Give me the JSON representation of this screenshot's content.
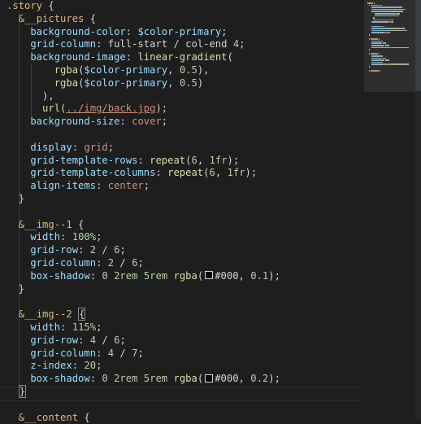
{
  "colors": {
    "background": "#1e1e1e",
    "selector": "#d7ba7d",
    "property": "#9cdcfe",
    "value": "#ce9178",
    "number": "#b5cea8",
    "function": "#dcdcaa",
    "variable": "#9cdcfe",
    "punct": "#d4d4d4",
    "link": "#ce9178",
    "comment": "#6a9955"
  },
  "code_lines": [
    [
      {
        "t": ".story",
        "c": "selector"
      },
      {
        "t": " {",
        "c": "punct"
      }
    ],
    [
      {
        "t": "  &",
        "c": "selector"
      },
      {
        "t": "__pictures",
        "c": "selector"
      },
      {
        "t": " {",
        "c": "punct"
      }
    ],
    [
      {
        "t": "    background-color",
        "c": "property"
      },
      {
        "t": ": ",
        "c": "punct"
      },
      {
        "t": "$color-primary",
        "c": "variable"
      },
      {
        "t": ";",
        "c": "punct"
      }
    ],
    [
      {
        "t": "    grid-column",
        "c": "property"
      },
      {
        "t": ": full-start / col-end ",
        "c": "punct"
      },
      {
        "t": "4",
        "c": "number"
      },
      {
        "t": ";",
        "c": "punct"
      }
    ],
    [
      {
        "t": "    background-image",
        "c": "property"
      },
      {
        "t": ": ",
        "c": "punct"
      },
      {
        "t": "linear-gradient",
        "c": "function"
      },
      {
        "t": "(",
        "c": "punct"
      }
    ],
    [
      {
        "t": "        rgba",
        "c": "function"
      },
      {
        "t": "(",
        "c": "punct"
      },
      {
        "t": "$color-primary",
        "c": "variable"
      },
      {
        "t": ", ",
        "c": "punct"
      },
      {
        "t": "0.5",
        "c": "number"
      },
      {
        "t": "),",
        "c": "punct"
      }
    ],
    [
      {
        "t": "        rgba",
        "c": "function"
      },
      {
        "t": "(",
        "c": "punct"
      },
      {
        "t": "$color-primary",
        "c": "variable"
      },
      {
        "t": ", ",
        "c": "punct"
      },
      {
        "t": "0.5",
        "c": "number"
      },
      {
        "t": ")",
        "c": "punct"
      }
    ],
    [
      {
        "t": "      ),",
        "c": "punct"
      }
    ],
    [
      {
        "t": "      url",
        "c": "function"
      },
      {
        "t": "(",
        "c": "punct"
      },
      {
        "t": "../img/back.jpg",
        "c": "link"
      },
      {
        "t": ");",
        "c": "punct"
      }
    ],
    [
      {
        "t": "    background-size",
        "c": "property"
      },
      {
        "t": ": ",
        "c": "punct"
      },
      {
        "t": "cover",
        "c": "value"
      },
      {
        "t": ";",
        "c": "punct"
      }
    ],
    [],
    [
      {
        "t": "    display",
        "c": "property"
      },
      {
        "t": ": ",
        "c": "punct"
      },
      {
        "t": "grid",
        "c": "value"
      },
      {
        "t": ";",
        "c": "punct"
      }
    ],
    [
      {
        "t": "    grid-template-rows",
        "c": "property"
      },
      {
        "t": ": ",
        "c": "punct"
      },
      {
        "t": "repeat",
        "c": "function"
      },
      {
        "t": "(",
        "c": "punct"
      },
      {
        "t": "6",
        "c": "number"
      },
      {
        "t": ", ",
        "c": "punct"
      },
      {
        "t": "1fr",
        "c": "number"
      },
      {
        "t": ");",
        "c": "punct"
      }
    ],
    [
      {
        "t": "    grid-template-columns",
        "c": "property"
      },
      {
        "t": ": ",
        "c": "punct"
      },
      {
        "t": "repeat",
        "c": "function"
      },
      {
        "t": "(",
        "c": "punct"
      },
      {
        "t": "6",
        "c": "number"
      },
      {
        "t": ", ",
        "c": "punct"
      },
      {
        "t": "1fr",
        "c": "number"
      },
      {
        "t": ");",
        "c": "punct"
      }
    ],
    [
      {
        "t": "    align-items",
        "c": "property"
      },
      {
        "t": ": ",
        "c": "punct"
      },
      {
        "t": "center",
        "c": "value"
      },
      {
        "t": ";",
        "c": "punct"
      }
    ],
    [
      {
        "t": "  }",
        "c": "punct"
      }
    ],
    [],
    [
      {
        "t": "  &",
        "c": "selector"
      },
      {
        "t": "__img--1",
        "c": "selector"
      },
      {
        "t": " {",
        "c": "punct"
      }
    ],
    [
      {
        "t": "    width",
        "c": "property"
      },
      {
        "t": ": ",
        "c": "punct"
      },
      {
        "t": "100%",
        "c": "number"
      },
      {
        "t": ";",
        "c": "punct"
      }
    ],
    [
      {
        "t": "    grid-row",
        "c": "property"
      },
      {
        "t": ": ",
        "c": "punct"
      },
      {
        "t": "2",
        "c": "number"
      },
      {
        "t": " / ",
        "c": "punct"
      },
      {
        "t": "6",
        "c": "number"
      },
      {
        "t": ";",
        "c": "punct"
      }
    ],
    [
      {
        "t": "    grid-column",
        "c": "property"
      },
      {
        "t": ": ",
        "c": "punct"
      },
      {
        "t": "2",
        "c": "number"
      },
      {
        "t": " / ",
        "c": "punct"
      },
      {
        "t": "6",
        "c": "number"
      },
      {
        "t": ";",
        "c": "punct"
      }
    ],
    [
      {
        "t": "    box-shadow",
        "c": "property"
      },
      {
        "t": ": ",
        "c": "punct"
      },
      {
        "t": "0 2rem 5rem ",
        "c": "number"
      },
      {
        "t": "rgba",
        "c": "function"
      },
      {
        "t": "(",
        "c": "punct"
      },
      {
        "t": "",
        "c": "swatch"
      },
      {
        "t": "#000",
        "c": "punct"
      },
      {
        "t": ", ",
        "c": "punct"
      },
      {
        "t": "0.1",
        "c": "number"
      },
      {
        "t": ");",
        "c": "punct"
      }
    ],
    [
      {
        "t": "  }",
        "c": "punct"
      }
    ],
    [],
    [
      {
        "t": "  &",
        "c": "selector"
      },
      {
        "t": "__img--2",
        "c": "selector"
      },
      {
        "t": " ",
        "c": "punct"
      },
      {
        "t": "{",
        "c": "cursor"
      }
    ],
    [
      {
        "t": "    width",
        "c": "property"
      },
      {
        "t": ": ",
        "c": "punct"
      },
      {
        "t": "115%",
        "c": "number"
      },
      {
        "t": ";",
        "c": "punct"
      }
    ],
    [
      {
        "t": "    grid-row",
        "c": "property"
      },
      {
        "t": ": ",
        "c": "punct"
      },
      {
        "t": "4",
        "c": "number"
      },
      {
        "t": " / ",
        "c": "punct"
      },
      {
        "t": "6",
        "c": "number"
      },
      {
        "t": ";",
        "c": "punct"
      }
    ],
    [
      {
        "t": "    grid-column",
        "c": "property"
      },
      {
        "t": ": ",
        "c": "punct"
      },
      {
        "t": "4",
        "c": "number"
      },
      {
        "t": " / ",
        "c": "punct"
      },
      {
        "t": "7",
        "c": "number"
      },
      {
        "t": ";",
        "c": "punct"
      }
    ],
    [
      {
        "t": "    z-index",
        "c": "property"
      },
      {
        "t": ": ",
        "c": "punct"
      },
      {
        "t": "20",
        "c": "number"
      },
      {
        "t": ";",
        "c": "punct"
      }
    ],
    [
      {
        "t": "    box-shadow",
        "c": "property"
      },
      {
        "t": ": ",
        "c": "punct"
      },
      {
        "t": "0 2rem 5rem ",
        "c": "number"
      },
      {
        "t": "rgba",
        "c": "function"
      },
      {
        "t": "(",
        "c": "punct"
      },
      {
        "t": "",
        "c": "swatch"
      },
      {
        "t": "#000",
        "c": "punct"
      },
      {
        "t": ", ",
        "c": "punct"
      },
      {
        "t": "0.2",
        "c": "number"
      },
      {
        "t": ");",
        "c": "punct"
      }
    ],
    [
      {
        "t": "  ",
        "c": "punct"
      },
      {
        "t": "}",
        "c": "cursor"
      }
    ],
    [],
    [
      {
        "t": "  &",
        "c": "selector"
      },
      {
        "t": "__content",
        "c": "selector"
      },
      {
        "t": " {",
        "c": "punct"
      }
    ]
  ]
}
